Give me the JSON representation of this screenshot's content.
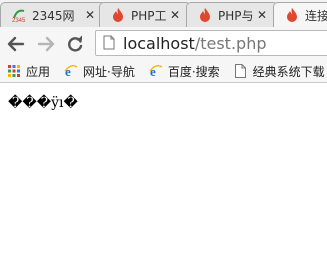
{
  "tabs": [
    {
      "title": "2345网",
      "active": false,
      "favicon": "2345-logo-icon"
    },
    {
      "title": "PHP工",
      "active": false,
      "favicon": "flame-icon"
    },
    {
      "title": "PHP与",
      "active": false,
      "favicon": "flame-icon"
    },
    {
      "title": "连接",
      "active": true,
      "favicon": "flame-icon"
    }
  ],
  "tab_close_glyph": "✕",
  "toolbar": {
    "url_host": "localhost",
    "url_path": "/test.php"
  },
  "bookmarks": [
    {
      "label": "应用",
      "icon": "apps-grid-icon"
    },
    {
      "label": "网址·导航",
      "icon": "ie-e-icon"
    },
    {
      "label": "百度·搜索",
      "icon": "ie-e-icon"
    },
    {
      "label": "经典系统下载",
      "icon": "page-icon"
    }
  ],
  "page": {
    "text": "���ÿı�"
  },
  "colors": {
    "flame": "#e0472f",
    "ie_blue": "#1d6fcf",
    "apps_red": "#d23f31",
    "apps_green": "#3a9d4a",
    "apps_yellow": "#f2b705",
    "apps_blue": "#3b78e7"
  }
}
